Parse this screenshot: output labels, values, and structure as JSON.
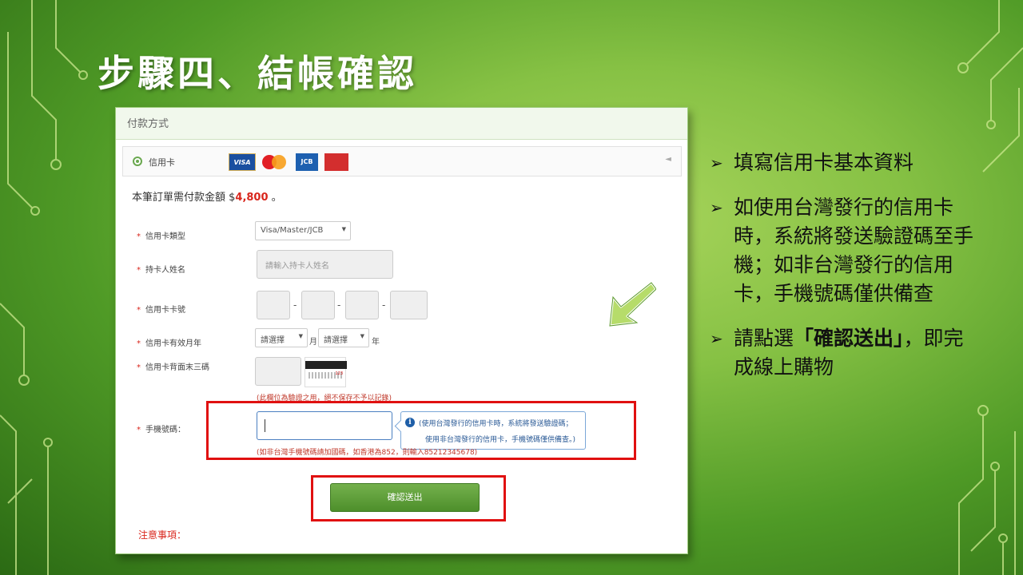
{
  "slide": {
    "title": "步驟四、結帳確認"
  },
  "panel": {
    "header": "付款方式",
    "method_label": "信用卡",
    "card_logos": [
      "VISA",
      "MasterCard",
      "JCB",
      "UnionPay"
    ],
    "amount_prefix": "本筆訂單需付款金額 $",
    "amount_value": "4,800",
    "amount_suffix": "。",
    "fields": {
      "card_type_label": "信用卡類型",
      "card_type_value": "Visa/Master/JCB",
      "holder_label": "持卡人姓名",
      "holder_placeholder": "請輸入持卡人姓名",
      "number_label": "信用卡卡號",
      "number_dash": "-",
      "expiry_label": "信用卡有效月年",
      "expiry_month_value": "請選擇",
      "expiry_month_unit": "月",
      "expiry_year_value": "請選擇",
      "expiry_year_unit": "年",
      "cvv_label": "信用卡背面末三碼",
      "cvv_note": "(此欄位為驗證之用，絕不保存不予以記錄)",
      "phone_label": "手機號碼：",
      "phone_note": "(如非台灣手機號碼請加國碼，如香港為852，則輸入85212345678)"
    },
    "tooltip": {
      "line1": "(使用台灣發行的信用卡時，系統將發送驗證碼；",
      "line2": "使用非台灣發行的信用卡，手機號碼僅供備查。)"
    },
    "submit_label": "確認送出",
    "notes_label": "注意事項："
  },
  "bullets": [
    {
      "text": "填寫信用卡基本資料"
    },
    {
      "text": "如使用台灣發行的信用卡時，系統將發送驗證碼至手機；如非台灣發行的信用卡，手機號碼僅供備查"
    },
    {
      "pre": "請點選",
      "strong": "「確認送出」",
      "post": "，即完成線上購物"
    }
  ],
  "colors": {
    "accent_green": "#6aa84f",
    "highlight_red": "#e01010",
    "amount_red": "#d9261c"
  },
  "icons": {
    "bullet": "arrow-bullet-icon",
    "pointer": "green-arrow-icon",
    "info": "info-icon"
  }
}
